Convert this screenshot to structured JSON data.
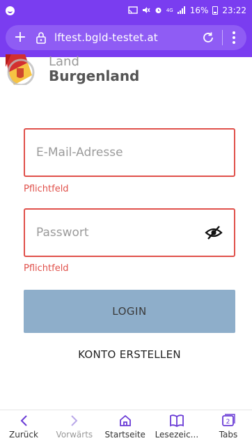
{
  "status_bar": {
    "battery": "16%",
    "time": "23:22",
    "network": "4G"
  },
  "address_bar": {
    "url": "lftest.bgld-testet.at"
  },
  "logo": {
    "line1": "Land",
    "line2": "Burgenland"
  },
  "form": {
    "email_placeholder": "E-Mail-Adresse",
    "email_value": "",
    "email_error": "Pflichtfeld",
    "password_placeholder": "Passwort",
    "password_value": "",
    "password_error": "Pflichtfeld",
    "login_label": "LOGIN",
    "create_account_label": "KONTO ERSTELLEN"
  },
  "bottom_nav": {
    "items": [
      {
        "label": "Zurück",
        "icon": "chevron-left-icon"
      },
      {
        "label": "Vorwärts",
        "icon": "chevron-right-icon"
      },
      {
        "label": "Startseite",
        "icon": "home-icon"
      },
      {
        "label": "Lesezeic...",
        "icon": "book-icon"
      },
      {
        "label": "Tabs",
        "icon": "tabs-icon",
        "count": "2"
      }
    ]
  },
  "colors": {
    "brand_purple": "#7a3df0",
    "error_red": "#e0504a",
    "login_button": "#8eaeca"
  }
}
